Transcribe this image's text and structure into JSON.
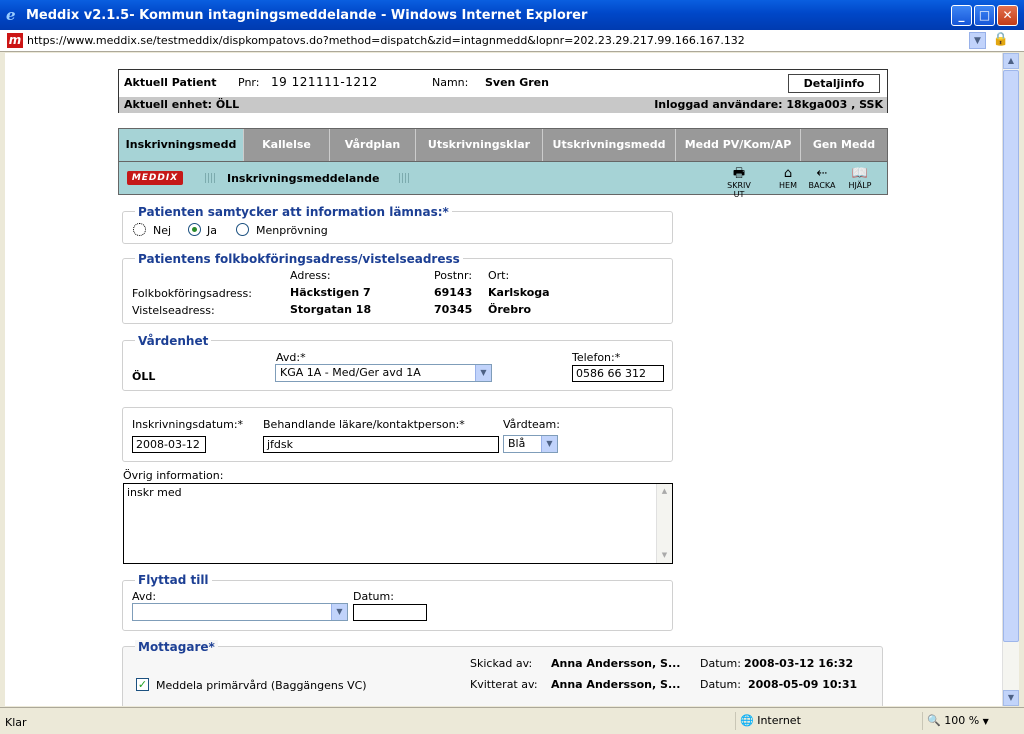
{
  "window": {
    "title": "Meddix v2.1.5- Kommun intagningsmeddelande - Windows Internet Explorer",
    "url": "https://www.meddix.se/testmeddix/dispkompatovs.do?method=dispatch&zid=intagnmedd&lopnr=202.23.29.217.99.166.167.132",
    "minimize": "_",
    "maximize": "□",
    "close": "✕"
  },
  "patient": {
    "label": "Aktuell Patient",
    "pnr_label": "Pnr:",
    "pnr": "19 121111-1212",
    "name_label": "Namn:",
    "name": "Sven Gren",
    "detail_button": "Detaljinfo",
    "unit": "Aktuell enhet: ÖLL",
    "user": "Inloggad användare: 18kga003 , SSK"
  },
  "tabs": [
    {
      "label": "Inskrivningsmedd"
    },
    {
      "label": "Kallelse"
    },
    {
      "label": "Vårdplan"
    },
    {
      "label": "Utskrivningsklar"
    },
    {
      "label": "Utskrivningsmedd"
    },
    {
      "label": "Medd PV/Kom/AP"
    },
    {
      "label": "Gen Medd"
    }
  ],
  "subbar": {
    "logo": "MEDDIX",
    "title": "Inskrivningsmeddelande",
    "tools": [
      {
        "label": "SKRIV UT",
        "icon": "printer-icon"
      },
      {
        "label": "HEM",
        "icon": "home-icon"
      },
      {
        "label": "BACKA",
        "icon": "back-arrow-icon"
      },
      {
        "label": "HJÄLP",
        "icon": "help-book-icon"
      }
    ]
  },
  "consent": {
    "legend": "Patienten samtycker att information lämnas:*",
    "options": [
      "Nej",
      "Ja",
      "Menprövning"
    ],
    "selected": "Ja"
  },
  "address": {
    "legend": "Patientens folkbokföringsadress/vistelseadress",
    "col_address": "Adress:",
    "col_postnr": "Postnr:",
    "col_ort": "Ort:",
    "rows": [
      {
        "label": "Folkbokföringsadress:",
        "address": "Häckstigen 7",
        "postnr": "69143",
        "ort": "Karlskoga"
      },
      {
        "label": "Vistelseadress:",
        "address": "Storgatan 18",
        "postnr": "70345",
        "ort": "Örebro"
      }
    ]
  },
  "care_unit": {
    "legend": "Vårdenhet",
    "unit": "ÖLL",
    "avd_label": "Avd:*",
    "avd_value": "KGA 1A - Med/Ger avd 1A",
    "phone_label": "Telefon:*",
    "phone_value": "0586 66 312"
  },
  "admission": {
    "date_label": "Inskrivningsdatum:*",
    "date_value": "2008-03-12",
    "doctor_label": "Behandlande läkare/kontaktperson:*",
    "doctor_value": "jfdsk",
    "team_label": "Vårdteam:",
    "team_value": "Blå"
  },
  "other_info": {
    "label": "Övrig information:",
    "value": "inskr med"
  },
  "moved": {
    "legend": "Flyttad till",
    "avd_label": "Avd:",
    "avd_value": "",
    "date_label": "Datum:",
    "date_value": ""
  },
  "recipients": {
    "legend": "Mottagare*",
    "rows": [
      {
        "checked": false,
        "label": "",
        "action_label": "Skickad av:",
        "person": "Anna Andersson, S...",
        "date_label": "Datum:",
        "date": "2008-03-12 16:32"
      },
      {
        "checked": true,
        "label": "Meddela primärvård  (Baggängens VC)",
        "action_label": "Kvitterat av:",
        "person": "Anna Andersson, S...",
        "date_label": "Datum:",
        "date": "2008-05-09 10:31"
      }
    ]
  },
  "status": {
    "text": "Klar",
    "zone": "Internet",
    "zoom": "100 %"
  }
}
